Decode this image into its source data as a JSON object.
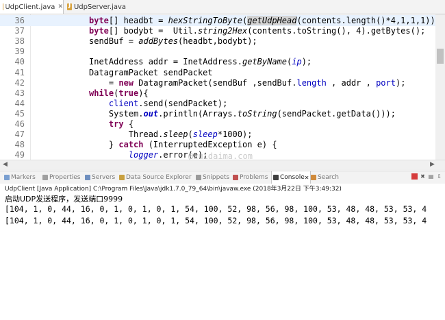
{
  "editor_tabs": [
    {
      "label": "UdpClient.java",
      "close": "✕",
      "active": true
    },
    {
      "label": "UdpServer.java",
      "active": false
    }
  ],
  "code_lines": [
    {
      "num": "36",
      "segments": [
        {
          "t": "byte",
          "c": "kw"
        },
        {
          "t": "[] headbt = ",
          "c": ""
        },
        {
          "t": "hexStringToByte",
          "c": "st"
        },
        {
          "t": "(",
          "c": ""
        },
        {
          "t": "getUdpHead",
          "c": "st hl"
        },
        {
          "t": "(contents.length()*4,1,1,1))",
          "c": ""
        }
      ]
    },
    {
      "num": "37",
      "segments": [
        {
          "t": "byte",
          "c": "kw"
        },
        {
          "t": "[] bodybt =  Util.",
          "c": ""
        },
        {
          "t": "string2Hex",
          "c": "st"
        },
        {
          "t": "(contents.toString(), 4).getBytes();",
          "c": ""
        }
      ]
    },
    {
      "num": "38",
      "segments": [
        {
          "t": "sendBuf = ",
          "c": ""
        },
        {
          "t": "addBytes",
          "c": "st"
        },
        {
          "t": "(headbt,bodybt);",
          "c": ""
        }
      ]
    },
    {
      "num": "39",
      "segments": []
    },
    {
      "num": "40",
      "segments": [
        {
          "t": "InetAddress addr = InetAddress.",
          "c": ""
        },
        {
          "t": "getByName",
          "c": "st"
        },
        {
          "t": "(",
          "c": ""
        },
        {
          "t": "ip",
          "c": "fld st"
        },
        {
          "t": ");",
          "c": ""
        }
      ]
    },
    {
      "num": "41",
      "segments": [
        {
          "t": "DatagramPacket sendPacket",
          "c": ""
        }
      ]
    },
    {
      "num": "42",
      "segments": [
        {
          "t": "    = ",
          "c": ""
        },
        {
          "t": "new",
          "c": "kw"
        },
        {
          "t": " DatagramPacket(sendBuf ,sendBuf.",
          "c": ""
        },
        {
          "t": "length",
          "c": "fld"
        },
        {
          "t": " , addr , ",
          "c": ""
        },
        {
          "t": "port",
          "c": "fld"
        },
        {
          "t": ");",
          "c": ""
        }
      ]
    },
    {
      "num": "43",
      "segments": [
        {
          "t": "while",
          "c": "kw"
        },
        {
          "t": "(",
          "c": ""
        },
        {
          "t": "true",
          "c": "kw"
        },
        {
          "t": "){",
          "c": ""
        }
      ]
    },
    {
      "num": "44",
      "segments": [
        {
          "t": "    ",
          "c": ""
        },
        {
          "t": "client",
          "c": "fld"
        },
        {
          "t": ".send(sendPacket);",
          "c": ""
        }
      ]
    },
    {
      "num": "45",
      "segments": [
        {
          "t": "    System.",
          "c": ""
        },
        {
          "t": "out",
          "c": "stf"
        },
        {
          "t": ".println(Arrays.",
          "c": ""
        },
        {
          "t": "toString",
          "c": "st"
        },
        {
          "t": "(sendPacket.getData()));",
          "c": ""
        }
      ]
    },
    {
      "num": "46",
      "segments": [
        {
          "t": "    ",
          "c": ""
        },
        {
          "t": "try",
          "c": "kw"
        },
        {
          "t": " {",
          "c": ""
        }
      ]
    },
    {
      "num": "47",
      "segments": [
        {
          "t": "        Thread.",
          "c": ""
        },
        {
          "t": "sleep",
          "c": "st"
        },
        {
          "t": "(",
          "c": ""
        },
        {
          "t": "sleep",
          "c": "fld st"
        },
        {
          "t": "*1000);",
          "c": ""
        }
      ]
    },
    {
      "num": "48",
      "segments": [
        {
          "t": "    } ",
          "c": ""
        },
        {
          "t": "catch",
          "c": "kw"
        },
        {
          "t": " (InterruptedException e) {",
          "c": ""
        }
      ]
    },
    {
      "num": "49",
      "segments": [
        {
          "t": "        ",
          "c": ""
        },
        {
          "t": "logger",
          "c": "fld st"
        },
        {
          "t": ".error(e);",
          "c": ""
        }
      ]
    }
  ],
  "watermark": "@zuidaima.com",
  "view_tabs": [
    {
      "label": "Markers",
      "color": "#7a9fd0"
    },
    {
      "label": "Properties",
      "color": "#a0a0a0"
    },
    {
      "label": "Servers",
      "color": "#6f8fbf"
    },
    {
      "label": "Data Source Explorer",
      "color": "#c8a040"
    },
    {
      "label": "Snippets",
      "color": "#9a9a9a"
    },
    {
      "label": "Problems",
      "color": "#c05050"
    },
    {
      "label": "Console",
      "color": "#404040",
      "active": true,
      "close": "✕"
    },
    {
      "label": "Search",
      "color": "#d08a3a"
    }
  ],
  "console": {
    "header": "UdpClient [Java Application] C:\\Program Files\\Java\\jdk1.7.0_79_64\\bin\\javaw.exe (2018年3月22日 下午3:49:32)",
    "lines": [
      "启动UDP发送程序，发送端口9999",
      "[104, 1, 0, 44, 16, 0, 1, 0, 1, 0, 1, 54, 100, 52, 98, 56, 98, 100, 53, 48, 48, 53, 53, 4",
      "[104, 1, 0, 44, 16, 0, 1, 0, 1, 0, 1, 54, 100, 52, 98, 56, 98, 100, 53, 48, 48, 53, 53, 4"
    ]
  },
  "colors": {
    "keyword": "#7f0055",
    "field": "#0000c0",
    "current_line": "#e8f2fe"
  }
}
